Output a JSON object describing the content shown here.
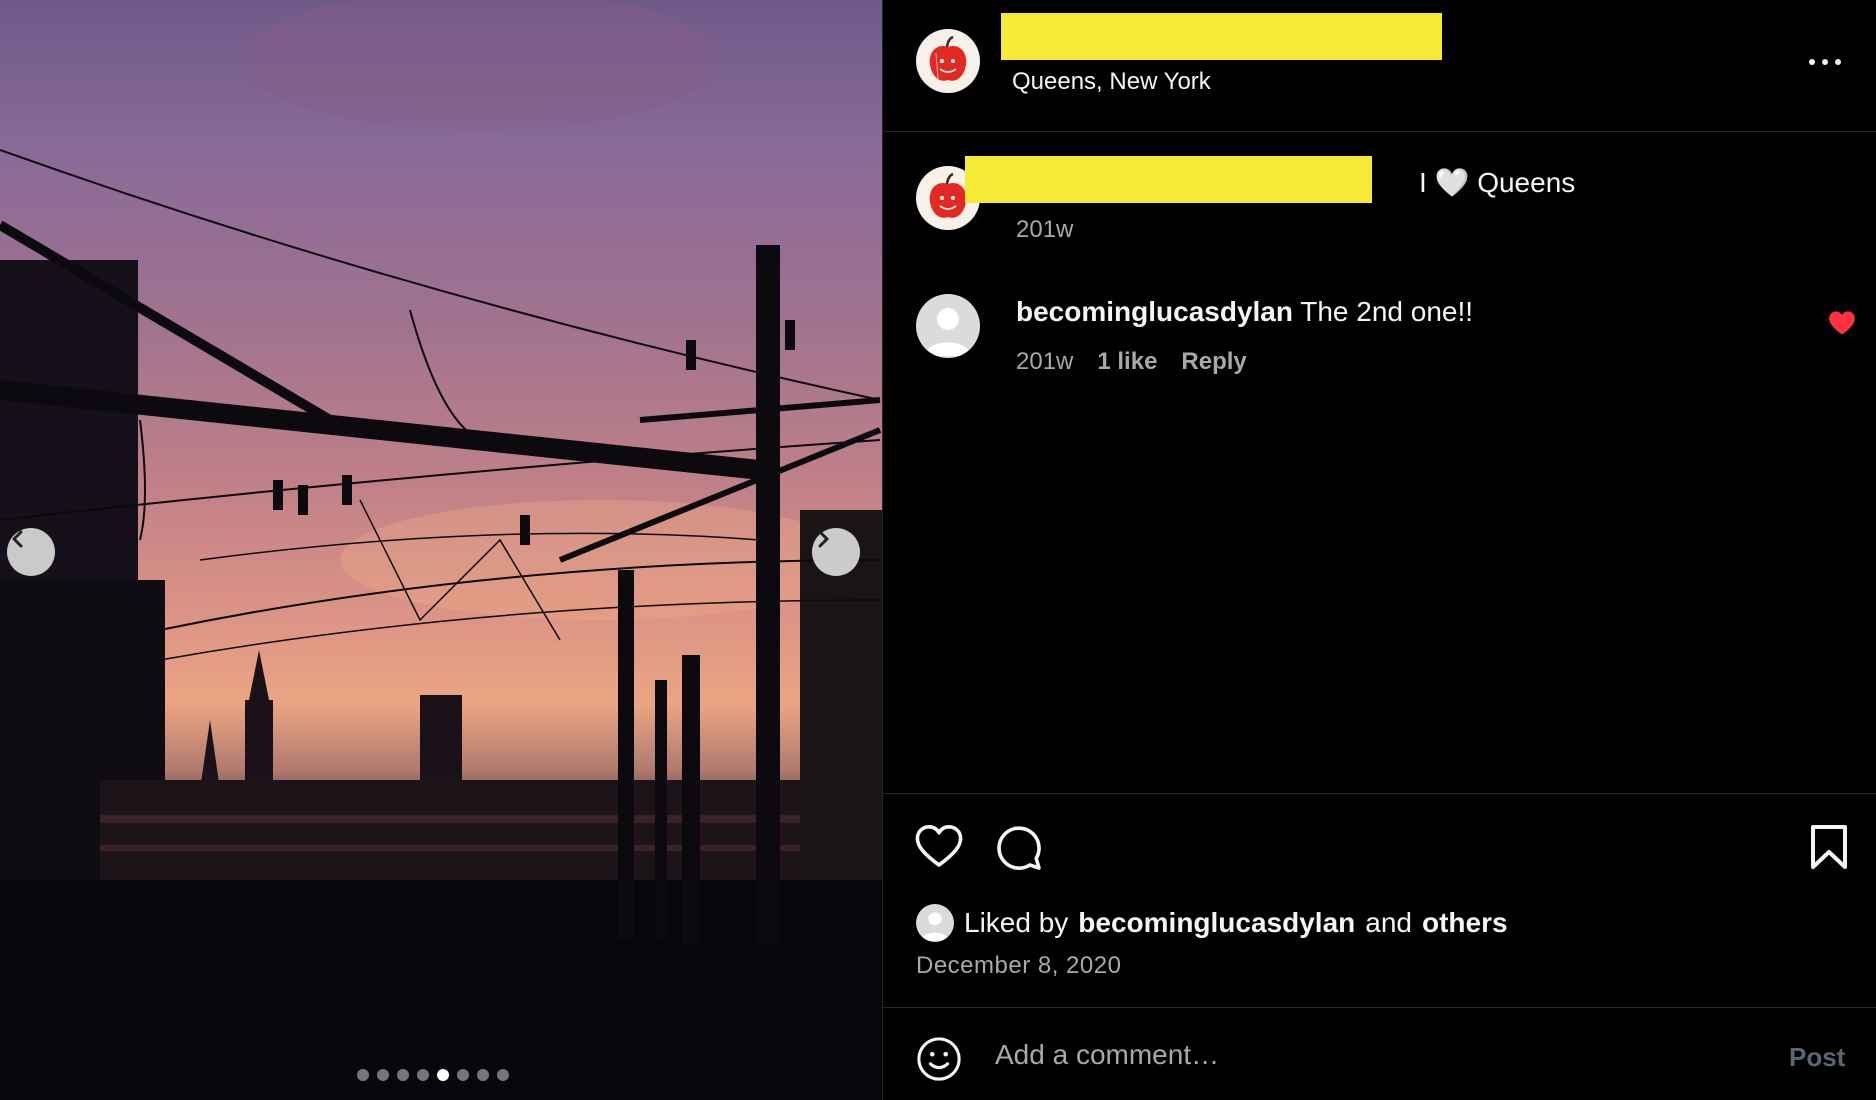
{
  "post": {
    "location": "Queens, New York",
    "menu_icon": "more-horizontal-icon",
    "carousel": {
      "total": 8,
      "active_index": 4
    }
  },
  "caption": {
    "text": "I 🤍 Queens",
    "time": "201w"
  },
  "comments": [
    {
      "username": "becominglucasdylan",
      "text": "The 2nd one!!",
      "time": "201w",
      "likes": "1 like",
      "reply_label": "Reply",
      "liked": true
    }
  ],
  "actions": {
    "liked_by_prefix": "Liked by",
    "liked_by_user": "becominglucasdylan",
    "liked_by_and": "and",
    "liked_by_others": "others",
    "date": "December 8, 2020"
  },
  "composer": {
    "placeholder": "Add a comment…",
    "post_label": "Post"
  },
  "colors": {
    "background": "#000000",
    "muted_text": "#a8a8a8",
    "like_red": "#ff3040",
    "redaction": "#f5ea36",
    "post_disabled": "#5a6672"
  }
}
